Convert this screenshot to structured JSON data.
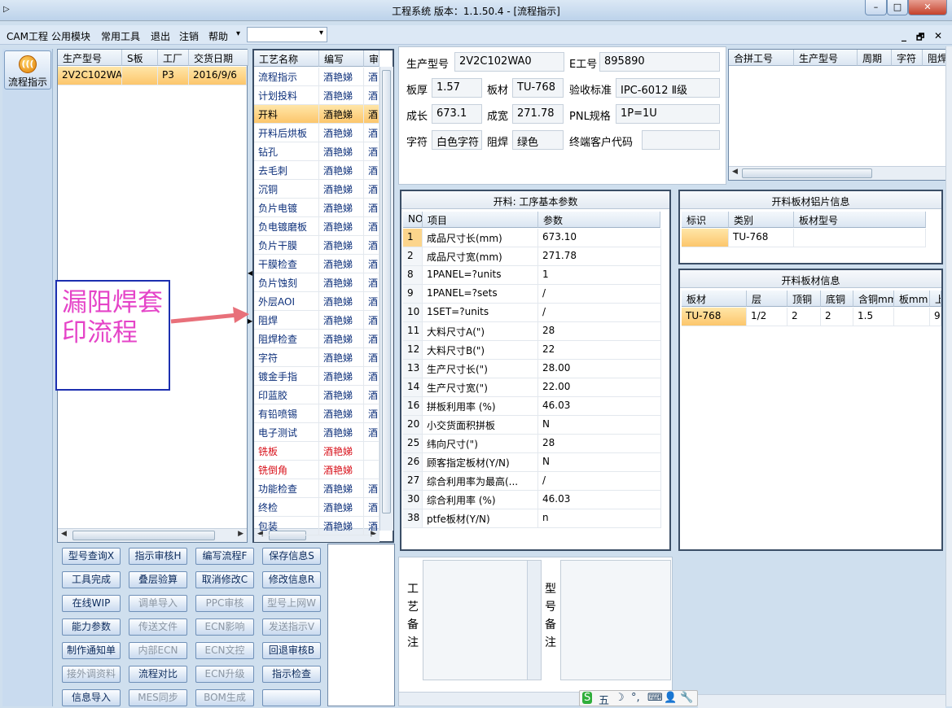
{
  "window": {
    "title": "工程系统   版本：1.1.50.4 - [流程指示]",
    "min": "–",
    "max": "□",
    "close": "✕"
  },
  "menu": {
    "items": [
      "CAM工程",
      "公用模块",
      "常用工具",
      "退出",
      "注销",
      "帮助"
    ],
    "dropdown_arrow": "▾",
    "mdi_min": "_",
    "mdi_restore": "🗗",
    "mdi_close": "✕"
  },
  "sidebar": {
    "button_label": "流程指示",
    "icon": "flow-icon",
    "icon_glyph": "((("
  },
  "orders": {
    "headers": [
      "生产型号",
      "S板",
      "工厂",
      "交货日期"
    ],
    "rows": [
      [
        "2V2C102WA0",
        "",
        "P3",
        "2016/9/6"
      ]
    ]
  },
  "process": {
    "headers": [
      "工艺名称",
      "编写",
      "审"
    ],
    "rows": [
      {
        "name": "流程指示",
        "editor": "酒艳娣",
        "audit": "酒",
        "style": "normal"
      },
      {
        "name": "计划投料",
        "editor": "酒艳娣",
        "audit": "酒",
        "style": "normal"
      },
      {
        "name": "开料",
        "editor": "酒艳娣",
        "audit": "酒",
        "style": "selected"
      },
      {
        "name": "开料后烘板",
        "editor": "酒艳娣",
        "audit": "酒",
        "style": "normal"
      },
      {
        "name": "钻孔",
        "editor": "酒艳娣",
        "audit": "酒",
        "style": "normal"
      },
      {
        "name": "去毛刺",
        "editor": "酒艳娣",
        "audit": "酒",
        "style": "normal"
      },
      {
        "name": "沉铜",
        "editor": "酒艳娣",
        "audit": "酒",
        "style": "normal"
      },
      {
        "name": "负片电镀",
        "editor": "酒艳娣",
        "audit": "酒",
        "style": "normal"
      },
      {
        "name": "负电镀磨板",
        "editor": "酒艳娣",
        "audit": "酒",
        "style": "normal"
      },
      {
        "name": "负片干膜",
        "editor": "酒艳娣",
        "audit": "酒",
        "style": "normal"
      },
      {
        "name": "干膜检查",
        "editor": "酒艳娣",
        "audit": "酒",
        "style": "normal"
      },
      {
        "name": "负片蚀刻",
        "editor": "酒艳娣",
        "audit": "酒",
        "style": "normal"
      },
      {
        "name": "外层AOI",
        "editor": "酒艳娣",
        "audit": "酒",
        "style": "normal"
      },
      {
        "name": "阻焊",
        "editor": "酒艳娣",
        "audit": "酒",
        "style": "normal"
      },
      {
        "name": "阻焊检查",
        "editor": "酒艳娣",
        "audit": "酒",
        "style": "normal"
      },
      {
        "name": "字符",
        "editor": "酒艳娣",
        "audit": "酒",
        "style": "normal"
      },
      {
        "name": "镀金手指",
        "editor": "酒艳娣",
        "audit": "酒",
        "style": "normal"
      },
      {
        "name": "印蓝胶",
        "editor": "酒艳娣",
        "audit": "酒",
        "style": "normal"
      },
      {
        "name": "有铅喷锡",
        "editor": "酒艳娣",
        "audit": "酒",
        "style": "normal"
      },
      {
        "name": "电子测试",
        "editor": "酒艳娣",
        "audit": "酒",
        "style": "normal"
      },
      {
        "name": "铣板",
        "editor": "酒艳娣",
        "audit": "",
        "style": "red"
      },
      {
        "name": "铣倒角",
        "editor": "酒艳娣",
        "audit": "",
        "style": "red"
      },
      {
        "name": "功能检查",
        "editor": "酒艳娣",
        "audit": "酒",
        "style": "normal"
      },
      {
        "name": "终检",
        "editor": "酒艳娣",
        "audit": "酒",
        "style": "normal"
      },
      {
        "name": "包装",
        "editor": "酒艳娣",
        "audit": "酒",
        "style": "normal"
      }
    ]
  },
  "info": {
    "model_label": "生产型号",
    "model": "2V2C102WA0",
    "e_label": "E工号",
    "e_no": "895890",
    "thick_label": "板厚",
    "thick": "1.57",
    "material_label": "板材",
    "material": "TU-768",
    "std_label": "验收标准",
    "std": "IPC-6012 Ⅱ级",
    "len_label": "成长",
    "len": "673.1",
    "wid_label": "成宽",
    "wid": "271.78",
    "pnl_label": "PNL规格",
    "pnl": "1P=1U",
    "char_label": "字符",
    "char": "白色字符",
    "mask_label": "阻焊",
    "mask": "绿色",
    "cust_label": "终端客户代码",
    "cust": ""
  },
  "merge": {
    "headers": [
      "合拼工号",
      "生产型号",
      "周期",
      "字符",
      "阻焊"
    ]
  },
  "params": {
    "title": "开料: 工序基本参数",
    "headers": [
      "NO",
      "项目",
      "参数"
    ],
    "rows": [
      [
        "1",
        "成品尺寸长(mm)",
        "673.10"
      ],
      [
        "2",
        "成品尺寸宽(mm)",
        "271.78"
      ],
      [
        "8",
        "1PANEL=?units",
        "1"
      ],
      [
        "9",
        "1PANEL=?sets",
        "/"
      ],
      [
        "10",
        "1SET=?units",
        "/"
      ],
      [
        "11",
        "大料尺寸A(\")",
        "28"
      ],
      [
        "12",
        "大料尺寸B(\")",
        "22"
      ],
      [
        "13",
        "生产尺寸长(\")",
        "28.00"
      ],
      [
        "14",
        "生产尺寸宽(\")",
        "22.00"
      ],
      [
        "16",
        "拼板利用率 (%)",
        "46.03"
      ],
      [
        "20",
        "小交货面积拼板",
        "N"
      ],
      [
        "25",
        "纬向尺寸(\")",
        "28"
      ],
      [
        "26",
        "顾客指定板材(Y/N)",
        "N"
      ],
      [
        "27",
        "综合利用率为最高(...",
        "/"
      ],
      [
        "30",
        "综合利用率 (%)",
        "46.03"
      ],
      [
        "38",
        "ptfe板材(Y/N)",
        "n"
      ]
    ]
  },
  "alu": {
    "title": "开料板材铝片信息",
    "headers": [
      "标识",
      "类别",
      "板材型号"
    ],
    "rows": [
      [
        "",
        "TU-768",
        ""
      ]
    ]
  },
  "sheet": {
    "title": "开料板材信息",
    "headers": [
      "板材",
      "层",
      "顶铜",
      "底铜",
      "含铜mm",
      "板mm",
      "上"
    ],
    "rows": [
      [
        "TU-768",
        "1/2",
        "2",
        "2",
        "1.5",
        "",
        "9"
      ]
    ]
  },
  "buttons": [
    {
      "label": "型号查询X",
      "enabled": true
    },
    {
      "label": "指示审核H",
      "enabled": true
    },
    {
      "label": "编写流程F",
      "enabled": true
    },
    {
      "label": "保存信息S",
      "enabled": true
    },
    {
      "label": "工具完成",
      "enabled": true
    },
    {
      "label": "叠层验算",
      "enabled": true
    },
    {
      "label": "取消修改C",
      "enabled": true
    },
    {
      "label": "修改信息R",
      "enabled": true
    },
    {
      "label": "在线WIP",
      "enabled": true
    },
    {
      "label": "调单导入",
      "enabled": false
    },
    {
      "label": "PPC审核",
      "enabled": false
    },
    {
      "label": "型号上网W",
      "enabled": false
    },
    {
      "label": "能力参数",
      "enabled": true
    },
    {
      "label": "传送文件",
      "enabled": false
    },
    {
      "label": "ECN影响",
      "enabled": false
    },
    {
      "label": "发送指示V",
      "enabled": false
    },
    {
      "label": "制作通知单",
      "enabled": true
    },
    {
      "label": "内部ECN",
      "enabled": false
    },
    {
      "label": "ECN文控",
      "enabled": false
    },
    {
      "label": "回退审核B",
      "enabled": true
    },
    {
      "label": "接外调资料",
      "enabled": false
    },
    {
      "label": "流程对比",
      "enabled": true
    },
    {
      "label": "ECN升级",
      "enabled": false
    },
    {
      "label": "指示检查",
      "enabled": true
    },
    {
      "label": "信息导入",
      "enabled": true
    },
    {
      "label": "MES同步",
      "enabled": false
    },
    {
      "label": "BOM生成",
      "enabled": false
    },
    {
      "label": "",
      "enabled": true
    }
  ],
  "remarks": {
    "process_label": "工艺备注",
    "model_label": "型号备注"
  },
  "annotation": {
    "text": "漏阻焊套印流程",
    "color": "#e544c8",
    "arrow_color": "#e8707a"
  },
  "ime": {
    "items": [
      "S",
      "五",
      "☽",
      "°,",
      "⌨",
      "👤",
      "🔧"
    ]
  }
}
